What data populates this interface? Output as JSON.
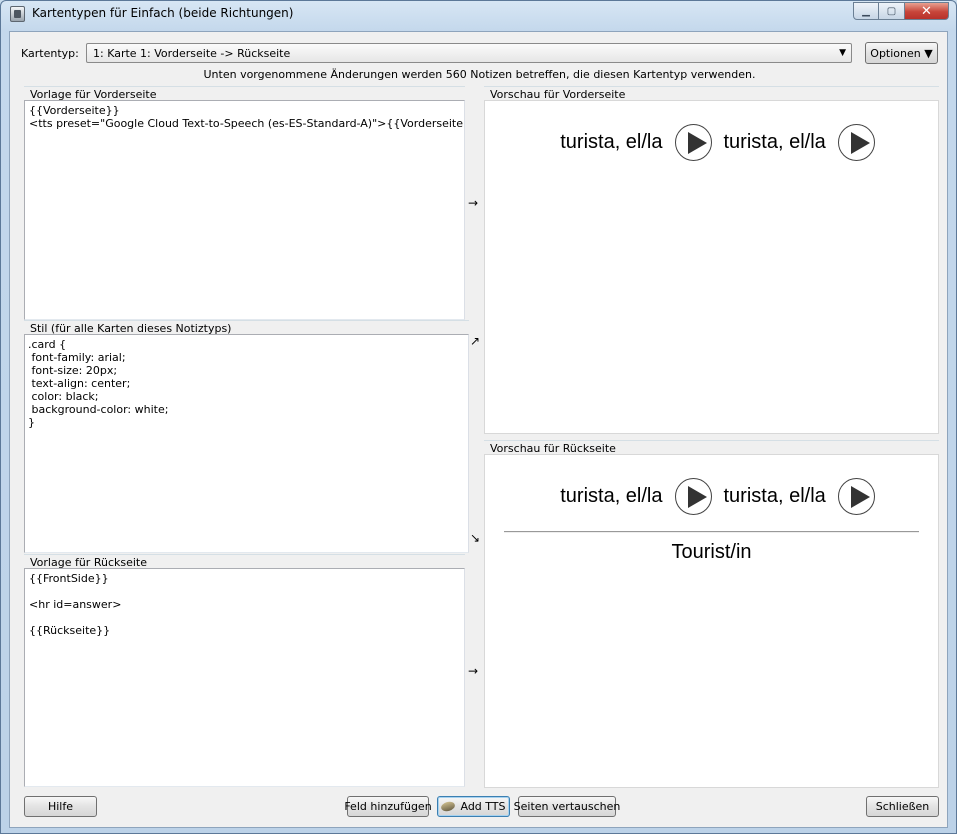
{
  "window": {
    "title": "Kartentypen für Einfach (beide Richtungen)",
    "icons": {
      "app": "anki-icon",
      "minimize": "minimize-icon",
      "maximize": "maximize-icon",
      "close": "close-icon"
    },
    "colors": {
      "close": "#c7453a",
      "frame": "#c4d8ec"
    }
  },
  "header": {
    "cardtype_label": "Kartentyp:",
    "cardtype_value": "1: Karte 1: Vorderseite -> Rückseite",
    "options_label": "Optionen ▼",
    "notice": "Unten vorgenommene Änderungen werden 560 Notizen betreffen, die diesen Kartentyp verwenden."
  },
  "front_template": {
    "title": "Vorlage für Vorderseite",
    "content": "{{Vorderseite}}\n<tts preset=\"Google Cloud Text-to-Speech (es-ES-Standard-A)\">{{Vorderseite}}</tts>"
  },
  "style": {
    "title": "Stil (für alle Karten dieses Notiztyps)",
    "content": ".card {\n font-family: arial;\n font-size: 20px;\n text-align: center;\n color: black;\n background-color: white;\n}"
  },
  "back_template": {
    "title": "Vorlage für Rückseite",
    "content": "{{FrontSide}}\n\n<hr id=answer>\n\n{{Rückseite}}"
  },
  "arrows": {
    "front": "→",
    "style_up": "↗",
    "style_down": "↘",
    "back": "→"
  },
  "front_preview": {
    "title": "Vorschau für Vorderseite",
    "word1": "turista, el/la",
    "word2": "turista, el/la"
  },
  "back_preview": {
    "title": "Vorschau für Rückseite",
    "word1": "turista, el/la",
    "word2": "turista, el/la",
    "answer": "Tourist/in"
  },
  "buttons": {
    "help": "Hilfe",
    "add_field": "Feld hinzufügen",
    "add_tts": "Add TTS",
    "swap_sides": "Seiten vertauschen",
    "close": "Schließen"
  }
}
